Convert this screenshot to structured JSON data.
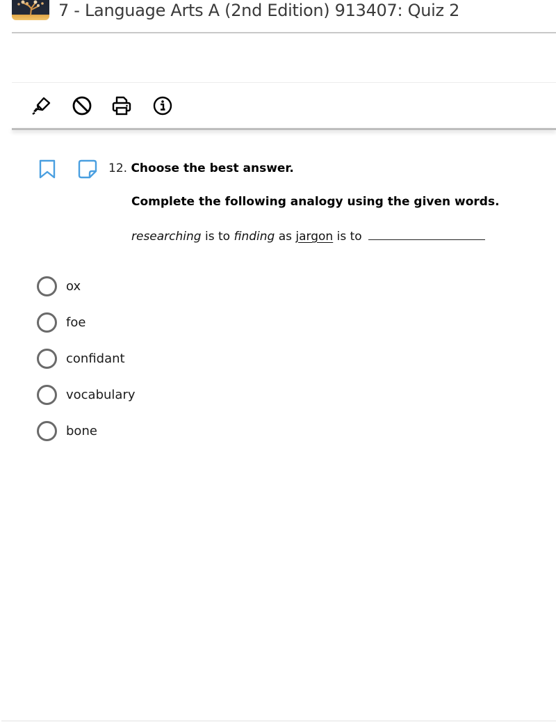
{
  "header": {
    "title": "7 - Language Arts A (2nd Edition) 913407: Quiz 2",
    "logo_icon": "tree-logo-icon"
  },
  "toolbar": {
    "tools": [
      {
        "name": "highlighter",
        "icon": "highlighter-icon"
      },
      {
        "name": "eliminate-answer",
        "icon": "prohibited-icon"
      },
      {
        "name": "print",
        "icon": "printer-icon"
      },
      {
        "name": "info",
        "icon": "info-icon"
      }
    ]
  },
  "question": {
    "bookmark_icon": "bookmark-icon",
    "note_icon": "note-icon",
    "number": "12.",
    "instruction": "Choose the best answer.",
    "prompt": "Complete the following analogy using the given words.",
    "analogy": {
      "word1": "researching",
      "connector1": "is to",
      "word2": "finding",
      "connector2": "as",
      "word3": "jargon",
      "connector3": "is to"
    },
    "options": [
      {
        "label": "ox",
        "selected": false
      },
      {
        "label": "foe",
        "selected": false
      },
      {
        "label": "confidant",
        "selected": false
      },
      {
        "label": "vocabulary",
        "selected": false
      },
      {
        "label": "bone",
        "selected": false
      }
    ]
  },
  "colors": {
    "accent_blue": "#4a9fe0",
    "radio_border": "#6a6a6a"
  }
}
